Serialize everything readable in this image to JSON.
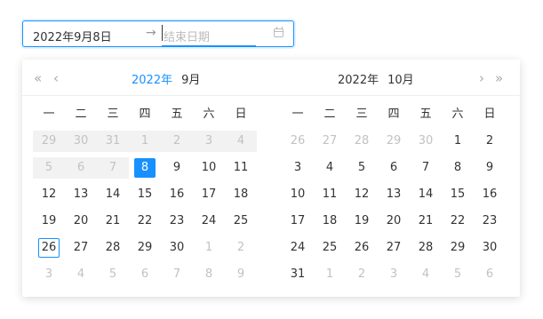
{
  "input": {
    "start_value": "2022年9月8日",
    "separator": "→",
    "end_placeholder": "结束日期",
    "calendar_icon": "calendar-icon"
  },
  "left": {
    "year": "2022年",
    "month": "9月",
    "weekdays": [
      "一",
      "二",
      "三",
      "四",
      "五",
      "六",
      "日"
    ],
    "rows": [
      [
        "29",
        "30",
        "31",
        "1",
        "2",
        "3",
        "4"
      ],
      [
        "5",
        "6",
        "7",
        "8",
        "9",
        "10",
        "11"
      ],
      [
        "12",
        "13",
        "14",
        "15",
        "16",
        "17",
        "18"
      ],
      [
        "19",
        "20",
        "21",
        "22",
        "23",
        "24",
        "25"
      ],
      [
        "26",
        "27",
        "28",
        "29",
        "30",
        "1",
        "2"
      ],
      [
        "3",
        "4",
        "5",
        "6",
        "7",
        "8",
        "9"
      ]
    ]
  },
  "right": {
    "year": "2022年",
    "month": "10月",
    "weekdays": [
      "一",
      "二",
      "三",
      "四",
      "五",
      "六",
      "日"
    ],
    "rows": [
      [
        "26",
        "27",
        "28",
        "29",
        "30",
        "1",
        "2"
      ],
      [
        "3",
        "4",
        "5",
        "6",
        "7",
        "8",
        "9"
      ],
      [
        "10",
        "11",
        "12",
        "13",
        "14",
        "15",
        "16"
      ],
      [
        "17",
        "18",
        "19",
        "20",
        "21",
        "22",
        "23"
      ],
      [
        "24",
        "25",
        "26",
        "27",
        "28",
        "29",
        "30"
      ],
      [
        "31",
        "1",
        "2",
        "3",
        "4",
        "5",
        "6"
      ]
    ]
  },
  "nav": {
    "prev_year": "«",
    "prev_month": "‹",
    "next_month": "›",
    "next_year": "»"
  },
  "colors": {
    "accent": "#1890ff",
    "muted": "#c2c2c2",
    "disabled_band": "#f2f2f2"
  }
}
